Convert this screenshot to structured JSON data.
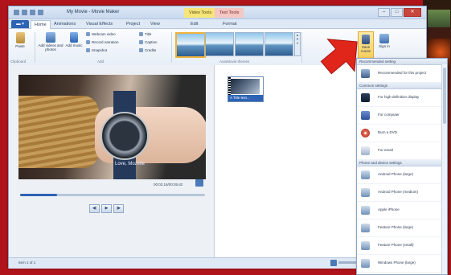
{
  "window": {
    "title": "My Movie - Movie Maker",
    "context_tabs": [
      "Video Tools",
      "Text Tools"
    ]
  },
  "ribbon": {
    "tabs": [
      "Home",
      "Animations",
      "Visual Effects",
      "Project",
      "View",
      "Edit",
      "Format"
    ],
    "clipboard": {
      "paste": "Paste",
      "group": "Clipboard"
    },
    "add": {
      "add_videos": "Add videos and photos",
      "add_music": "Add music",
      "webcam": "Webcam video",
      "record_narration": "Record narration",
      "snapshot": "Snapshot",
      "title": "Title",
      "caption": "Caption",
      "credits": "Credits",
      "group": "Add"
    },
    "themes_group": "AutoMovie themes",
    "save_movie": "Save movie",
    "sign_in": "Sign in"
  },
  "preview": {
    "caption": "Love, Mozelle",
    "timecode": "00:03.16/00:05.82"
  },
  "storyboard": {
    "clip_label": "A Title text..."
  },
  "status": {
    "text": "Item 1 of 1"
  },
  "save_menu": {
    "sections": [
      {
        "header": "Recommended setting",
        "items": [
          "Recommended for this project"
        ]
      },
      {
        "header": "Common settings",
        "items": [
          "For high-definition display",
          "For computer",
          "Burn a DVD",
          "For email"
        ]
      },
      {
        "header": "Phone and device settings",
        "items": [
          "Android Phone (large)",
          "Android Phone (medium)",
          "Apple iPhone",
          "Feature Phone (large)",
          "Feature Phone (small)",
          "Windows Phone (large)"
        ]
      }
    ]
  },
  "colors": {
    "accent": "#2d63b4",
    "frame": "#b0141a",
    "arrow": "#e0251b",
    "highlight": "#f0b23c"
  }
}
